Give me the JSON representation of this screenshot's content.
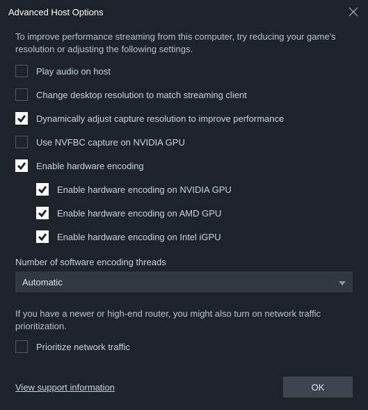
{
  "title": "Advanced Host Options",
  "intro": "To improve performance streaming from this computer, try reducing your game's resolution or adjusting the following settings.",
  "options": {
    "play_audio": {
      "label": "Play audio on host",
      "checked": false
    },
    "change_res": {
      "label": "Change desktop resolution to match streaming client",
      "checked": false
    },
    "dyn_adjust": {
      "label": "Dynamically adjust capture resolution to improve performance",
      "checked": true
    },
    "nvfbc": {
      "label": "Use NVFBC capture on NVIDIA GPU",
      "checked": false
    },
    "hw_enc": {
      "label": "Enable hardware encoding",
      "checked": true
    },
    "hw_nvidia": {
      "label": "Enable hardware encoding on NVIDIA GPU",
      "checked": true
    },
    "hw_amd": {
      "label": "Enable hardware encoding on AMD GPU",
      "checked": true
    },
    "hw_intel": {
      "label": "Enable hardware encoding on Intel iGPU",
      "checked": true
    },
    "prioritize": {
      "label": "Prioritize network traffic",
      "checked": false
    }
  },
  "threads": {
    "label": "Number of software encoding threads",
    "value": "Automatic"
  },
  "router_note": "If you have a newer or high-end router, you might also turn on network traffic prioritization.",
  "support_link": "View support information",
  "ok_label": "OK"
}
